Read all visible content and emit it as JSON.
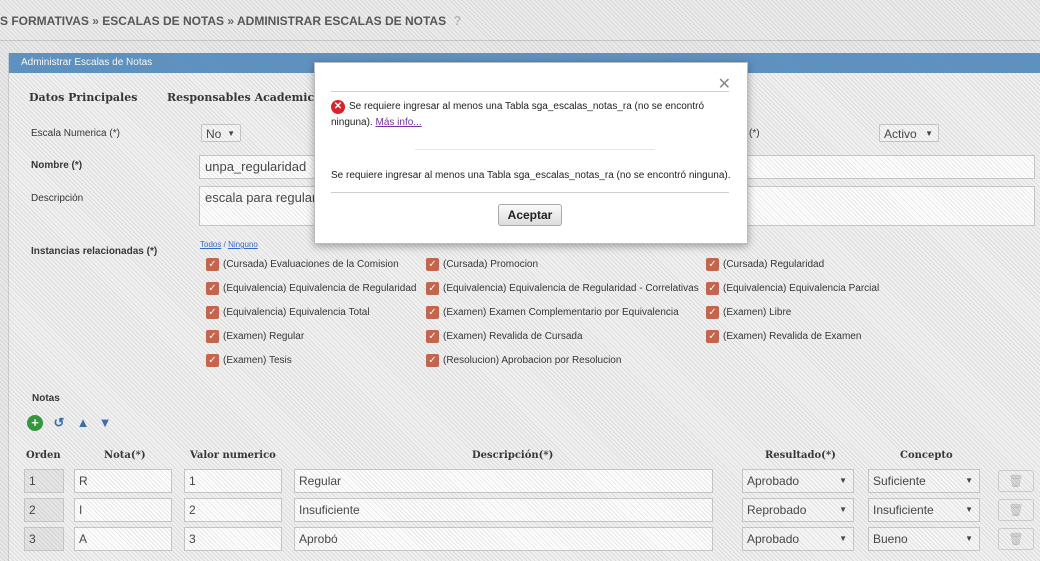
{
  "breadcrumb": {
    "part1": "S FORMATIVAS",
    "sep": "»",
    "part2": "ESCALAS DE NOTAS",
    "part3": "ADMINISTRAR ESCALAS DE NOTAS",
    "help": "?"
  },
  "panel": {
    "title": "Administrar Escalas de Notas"
  },
  "tabs": [
    "Datos Principales",
    "Responsables Academic"
  ],
  "form": {
    "escala_numerica_label": "Escala Numerica (*)",
    "escala_numerica_value": "No",
    "estado_label_suffix": "(*)",
    "estado_value": "Activo",
    "nombre_label": "Nombre (*)",
    "nombre_value": "unpa_regularidad",
    "descripcion_label": "Descripción",
    "descripcion_value": "escala para regular",
    "instancias_label": "Instancias relacionadas (*)",
    "todos": "Todos",
    "slash": "/",
    "ninguno": "Ninguno"
  },
  "instancias": [
    "(Cursada) Evaluaciones de la Comision",
    "(Cursada) Promocion",
    "(Cursada) Regularidad",
    "(Equivalencia) Equivalencia de Regularidad",
    "(Equivalencia) Equivalencia de Regularidad - Correlativas",
    "(Equivalencia) Equivalencia Parcial",
    "(Equivalencia) Equivalencia Total",
    "(Examen) Examen Complementario por Equivalencia",
    "(Examen) Libre",
    "(Examen) Regular",
    "(Examen) Revalida de Cursada",
    "(Examen) Revalida de Examen",
    "(Examen) Tesis",
    "(Resolucion) Aprobacion por Resolucion"
  ],
  "notas": {
    "section_label": "Notas",
    "headers": [
      "Orden",
      "Nota(*)",
      "Valor numerico",
      "Descripción(*)",
      "Resultado(*)",
      "Concepto"
    ],
    "rows": [
      {
        "orden": "1",
        "nota": "R",
        "valor": "1",
        "descripcion": "Regular",
        "resultado": "Aprobado",
        "concepto": "Suficiente"
      },
      {
        "orden": "2",
        "nota": "I",
        "valor": "2",
        "descripcion": "Insuficiente",
        "resultado": "Reprobado",
        "concepto": "Insuficiente"
      },
      {
        "orden": "3",
        "nota": "A",
        "valor": "3",
        "descripcion": "Aprobó",
        "resultado": "Aprobado",
        "concepto": "Bueno"
      }
    ]
  },
  "dialog": {
    "close": "✕",
    "error_message": "Se requiere ingresar al menos una Tabla sga_escalas_notas_ra (no se encontró ninguna).",
    "more_info": "Más info...",
    "detail_message": "Se requiere ingresar al menos una Tabla sga_escalas_notas_ra (no se encontró ninguna).",
    "accept_label": "Aceptar"
  },
  "colors": {
    "header_blue": "#5d93c4",
    "checkbox": "#c9634a",
    "error_red": "#d8232a",
    "add_green": "#2e9a3a"
  }
}
